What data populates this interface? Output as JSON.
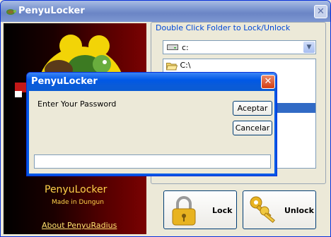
{
  "window": {
    "title": "PenyuLocker",
    "close_glyph": "✕"
  },
  "left_panel": {
    "app_name": "PenyuLocker",
    "tagline": "Made in Dungun",
    "about_link": "About PenyuRadius"
  },
  "folder_group": {
    "label": "Double Click Folder to Lock/Unlock"
  },
  "drive_select": {
    "value": "c:",
    "icon": "drive-icon"
  },
  "folder_list": {
    "items": [
      {
        "label": "C:\\",
        "icon": "open-folder-icon"
      }
    ]
  },
  "buttons": {
    "lock": {
      "label": "Lock",
      "icon": "padlock-icon"
    },
    "unlock": {
      "label": "Unlock",
      "icon": "keys-icon"
    }
  },
  "dialog": {
    "title": "PenyuLocker",
    "close_glyph": "✕",
    "prompt": "Enter Your Password",
    "accept_label": "Aceptar",
    "cancel_label": "Cancelar",
    "password_value": ""
  },
  "colors": {
    "xp_blue": "#0058e6",
    "panel_accent": "#ffd24a",
    "selection": "#316ac5"
  }
}
